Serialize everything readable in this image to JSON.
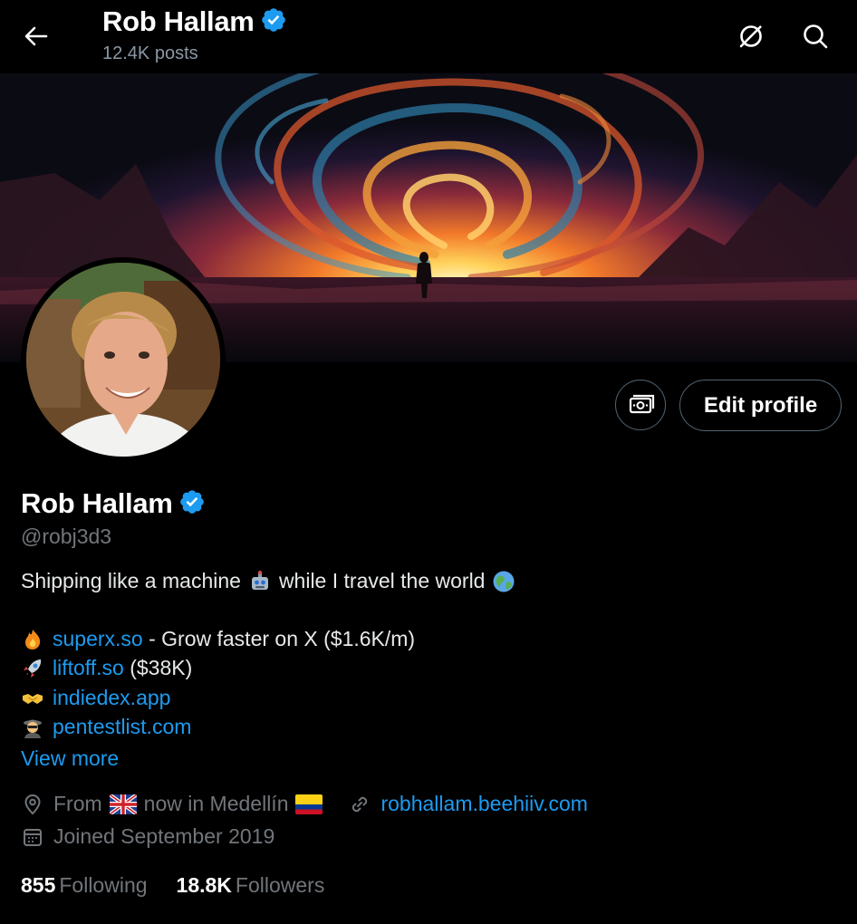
{
  "header": {
    "name": "Rob Hallam",
    "posts": "12.4K posts",
    "icons": [
      "back-arrow-icon",
      "verified-badge-icon",
      "grok-icon",
      "search-icon"
    ]
  },
  "profile": {
    "display_name": "Rob Hallam",
    "handle": "@robj3d3",
    "edit_profile_label": "Edit profile",
    "bio": {
      "line1_part1": "Shipping like a machine",
      "line1_part2": "while I travel the world",
      "projects": [
        {
          "emoji": "fire",
          "link": "superx.so",
          "text": " - Grow faster on X ($1.6K/m)"
        },
        {
          "emoji": "rocket",
          "link": "liftoff.so",
          "text": " ($38K)"
        },
        {
          "emoji": "handshake",
          "link": "indiedex.app",
          "text": ""
        },
        {
          "emoji": "spy",
          "link": "pentestlist.com",
          "text": ""
        }
      ],
      "view_more": "View more"
    },
    "location_from": "From",
    "location_now": "now in Medellín",
    "website": "robhallam.beehiiv.com",
    "joined": "Joined September 2019",
    "following_count": "855",
    "following_label": "Following",
    "followers_count": "18.8K",
    "followers_label": "Followers"
  },
  "colors": {
    "background": "#000000",
    "accent": "#1d9bf0",
    "secondary_text": "#71767b",
    "button_border": "#536471"
  }
}
